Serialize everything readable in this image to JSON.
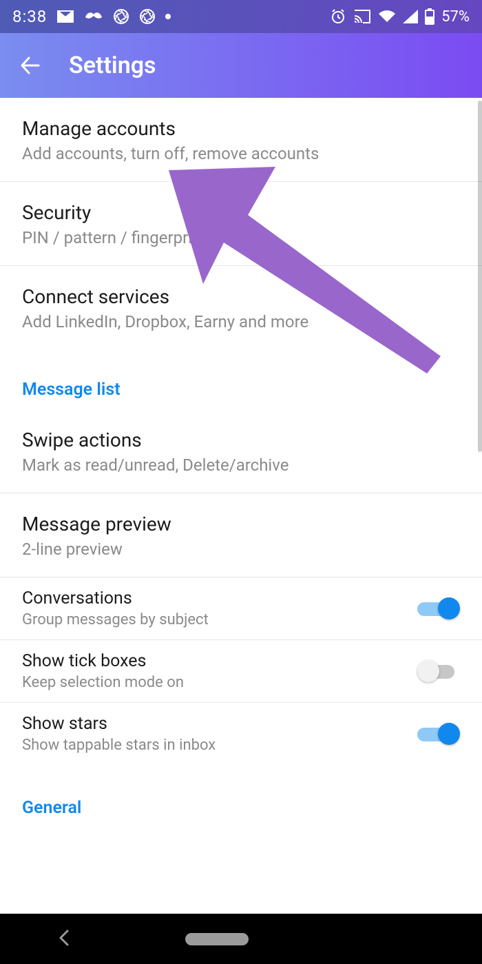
{
  "status": {
    "time": "8:38",
    "battery_pct": "57%"
  },
  "header": {
    "title": "Settings"
  },
  "rows": {
    "manage_accounts": {
      "title": "Manage accounts",
      "sub": "Add accounts, turn off, remove accounts"
    },
    "security": {
      "title": "Security",
      "sub": "PIN / pattern / fingerprint"
    },
    "connect_services": {
      "title": "Connect services",
      "sub": "Add LinkedIn, Dropbox, Earny and more"
    },
    "swipe_actions": {
      "title": "Swipe actions",
      "sub": "Mark as read/unread, Delete/archive"
    },
    "message_preview": {
      "title": "Message preview",
      "sub": "2-line preview"
    },
    "conversations": {
      "title": "Conversations",
      "sub": "Group messages by subject",
      "toggle": true
    },
    "show_tick_boxes": {
      "title": "Show tick boxes",
      "sub": "Keep selection mode on",
      "toggle": false
    },
    "show_stars": {
      "title": "Show stars",
      "sub": "Show tappable stars in inbox",
      "toggle": true
    }
  },
  "sections": {
    "message_list": "Message list",
    "general": "General"
  },
  "annotation": {
    "arrow_color": "#9966cc"
  }
}
